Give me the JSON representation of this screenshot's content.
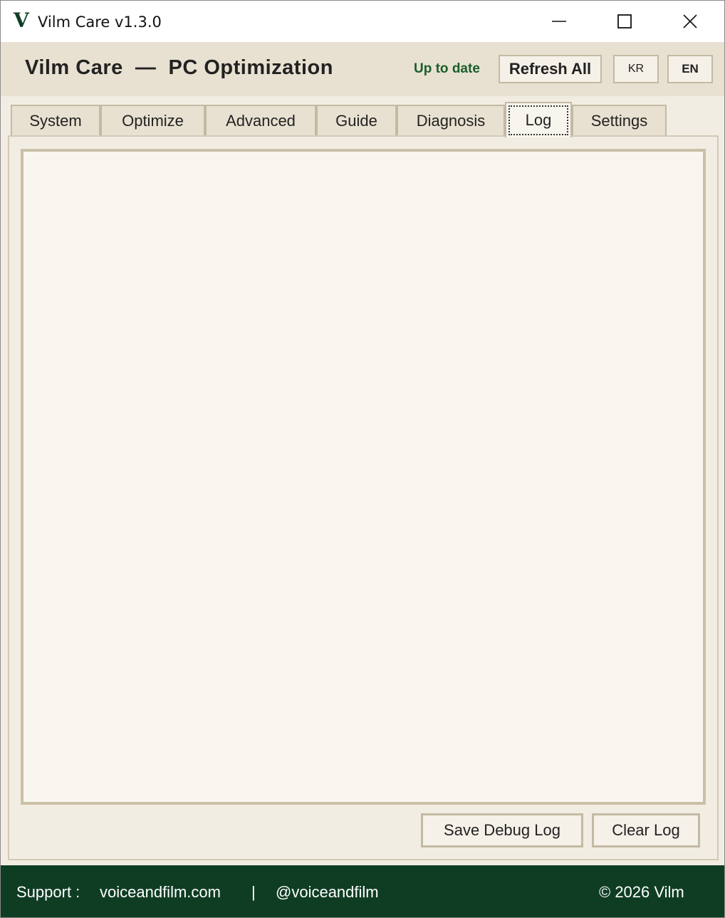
{
  "window": {
    "logo": "V",
    "title": "Vilm Care v1.3.0"
  },
  "header": {
    "app_name": "Vilm Care  —  PC Optimization",
    "status": "Up to date",
    "refresh_label": "Refresh All",
    "lang_kr": "KR",
    "lang_en": "EN"
  },
  "tabs": [
    {
      "label": "System"
    },
    {
      "label": "Optimize"
    },
    {
      "label": "Advanced"
    },
    {
      "label": "Guide"
    },
    {
      "label": "Diagnosis"
    },
    {
      "label": "Log"
    },
    {
      "label": "Settings"
    }
  ],
  "active_tab": "Log",
  "log": {
    "content": "",
    "save_label": "Save Debug Log",
    "clear_label": "Clear Log"
  },
  "footer": {
    "support_label": "Support :",
    "website": "voiceandfilm.com",
    "separator": "|",
    "handle": "@voiceandfilm",
    "copyright": "© 2026 Vilm"
  },
  "colors": {
    "brand_green": "#0f3d24",
    "status_green": "#1b5e2b",
    "header_bg": "#e8e1d1",
    "panel_bg": "#f1ede3",
    "border": "#c4b9a2"
  }
}
